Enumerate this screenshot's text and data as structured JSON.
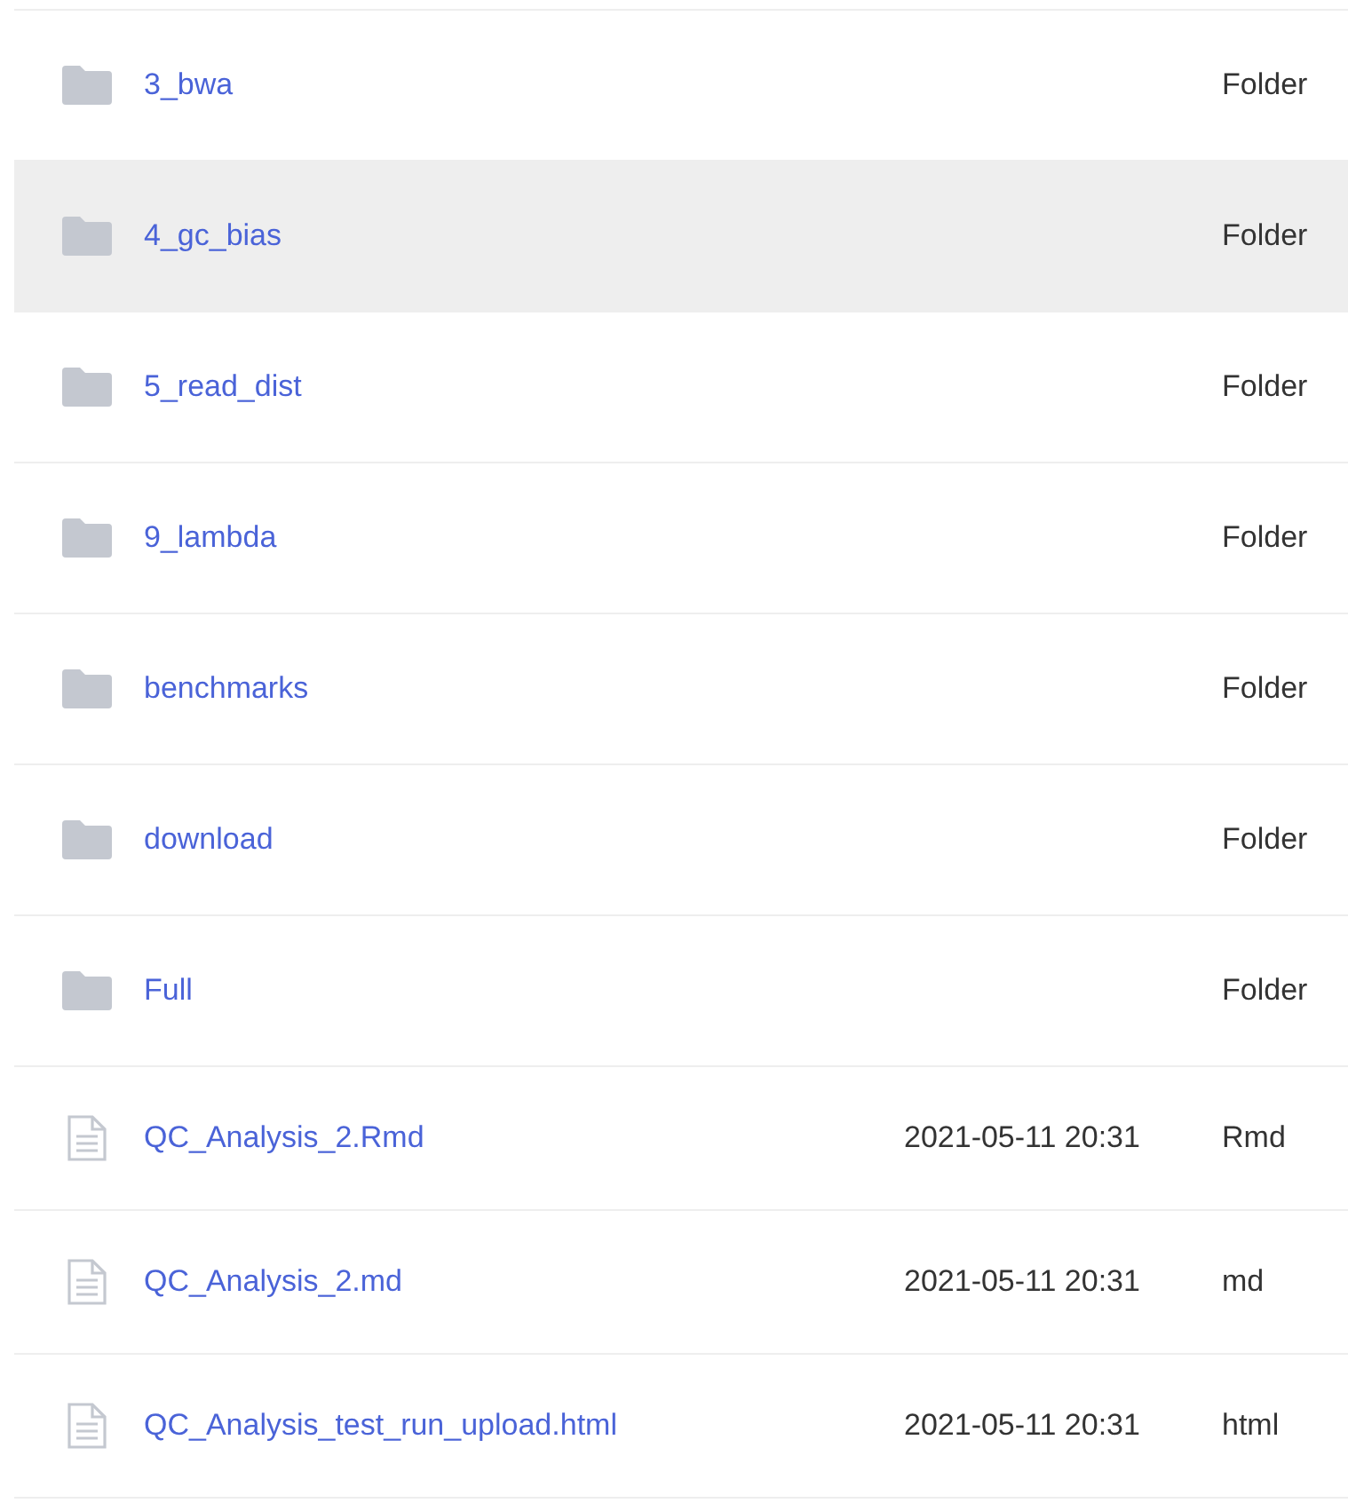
{
  "files": [
    {
      "kind": "folder",
      "name": "3_bwa",
      "type": "Folder",
      "highlighted": false
    },
    {
      "kind": "folder",
      "name": "4_gc_bias",
      "type": "Folder",
      "highlighted": true
    },
    {
      "kind": "folder",
      "name": "5_read_dist",
      "type": "Folder",
      "highlighted": false
    },
    {
      "kind": "folder",
      "name": "9_lambda",
      "type": "Folder",
      "highlighted": false
    },
    {
      "kind": "folder",
      "name": "benchmarks",
      "type": "Folder",
      "highlighted": false
    },
    {
      "kind": "folder",
      "name": "download",
      "type": "Folder",
      "highlighted": false
    },
    {
      "kind": "folder",
      "name": "Full",
      "type": "Folder",
      "highlighted": false
    },
    {
      "kind": "file",
      "name": "QC_Analysis_2.Rmd",
      "modified": "2021-05-11 20:31",
      "type": "Rmd",
      "highlighted": false
    },
    {
      "kind": "file",
      "name": "QC_Analysis_2.md",
      "modified": "2021-05-11 20:31",
      "type": "md",
      "highlighted": false
    },
    {
      "kind": "file",
      "name": "QC_Analysis_test_run_upload.html",
      "modified": "2021-05-11 20:31",
      "type": "html",
      "highlighted": false
    }
  ]
}
